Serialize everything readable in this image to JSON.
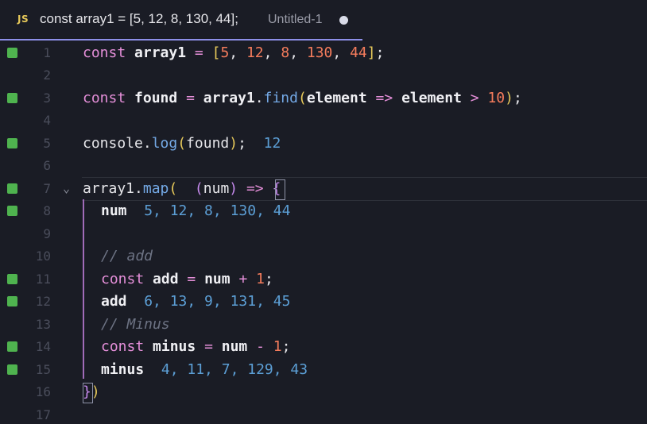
{
  "tab": {
    "icon_label": "JS",
    "title": "const array1 = [5, 12, 8, 130, 44];",
    "file_name": "Untitled-1"
  },
  "lines": [
    {
      "n": "1",
      "mark": true
    },
    {
      "n": "2",
      "mark": false
    },
    {
      "n": "3",
      "mark": true
    },
    {
      "n": "4",
      "mark": false
    },
    {
      "n": "5",
      "mark": true
    },
    {
      "n": "6",
      "mark": false
    },
    {
      "n": "7",
      "mark": true
    },
    {
      "n": "8",
      "mark": true
    },
    {
      "n": "9",
      "mark": false
    },
    {
      "n": "10",
      "mark": false
    },
    {
      "n": "11",
      "mark": true
    },
    {
      "n": "12",
      "mark": true
    },
    {
      "n": "13",
      "mark": false
    },
    {
      "n": "14",
      "mark": true
    },
    {
      "n": "15",
      "mark": true
    },
    {
      "n": "16",
      "mark": false
    },
    {
      "n": "17",
      "mark": false
    }
  ],
  "code": {
    "l1": {
      "kw": "const",
      "name": "array1",
      "eq": "=",
      "open": "[",
      "v1": "5",
      "c1": ", ",
      "v2": "12",
      "c2": ", ",
      "v3": "8",
      "c3": ", ",
      "v4": "130",
      "c4": ", ",
      "v5": "44",
      "close": "]",
      "semi": ";"
    },
    "l3": {
      "kw": "const",
      "name": "found",
      "eq": "=",
      "obj": "array1",
      "dot": ".",
      "fn": "find",
      "open": "(",
      "arg": "element",
      "arrow": "=>",
      "arg2": "element",
      "gt": ">",
      "num": "10",
      "close": ")",
      "semi": ";"
    },
    "l5": {
      "obj": "console",
      "dot": ".",
      "fn": "log",
      "open": "(",
      "arg": "found",
      "close": ")",
      "semi": ";",
      "result": "12"
    },
    "l7": {
      "obj": "array1",
      "dot": ".",
      "fn": "map",
      "open": "(",
      "popen": "(",
      "arg": "num",
      "pclose": ")",
      "arrow": "=>",
      "brace": "{"
    },
    "l8": {
      "name": "num",
      "result": "5, 12, 8, 130, 44"
    },
    "l10": {
      "comment": "// add"
    },
    "l11": {
      "kw": "const",
      "name": "add",
      "eq": "=",
      "a": "num",
      "op": "+",
      "num": "1",
      "semi": ";"
    },
    "l12": {
      "name": "add",
      "result": "6, 13, 9, 131, 45"
    },
    "l13": {
      "comment": "// Minus"
    },
    "l14": {
      "kw": "const",
      "name": "minus",
      "eq": "=",
      "a": "num",
      "op": "-",
      "num": "1",
      "semi": ";"
    },
    "l15": {
      "name": "minus",
      "result": "4, 11, 7, 129, 43"
    },
    "l16": {
      "brace": "}",
      "close": ")"
    }
  },
  "colors": {
    "background": "#1a1c25",
    "keyword": "#e58fd9",
    "number": "#f57c5c",
    "function": "#74a9e6",
    "inline_result": "#5c9fd6",
    "comment": "#6d7384",
    "gutter_mark": "#4fb34f",
    "tab_underline": "#8d8fe8"
  }
}
